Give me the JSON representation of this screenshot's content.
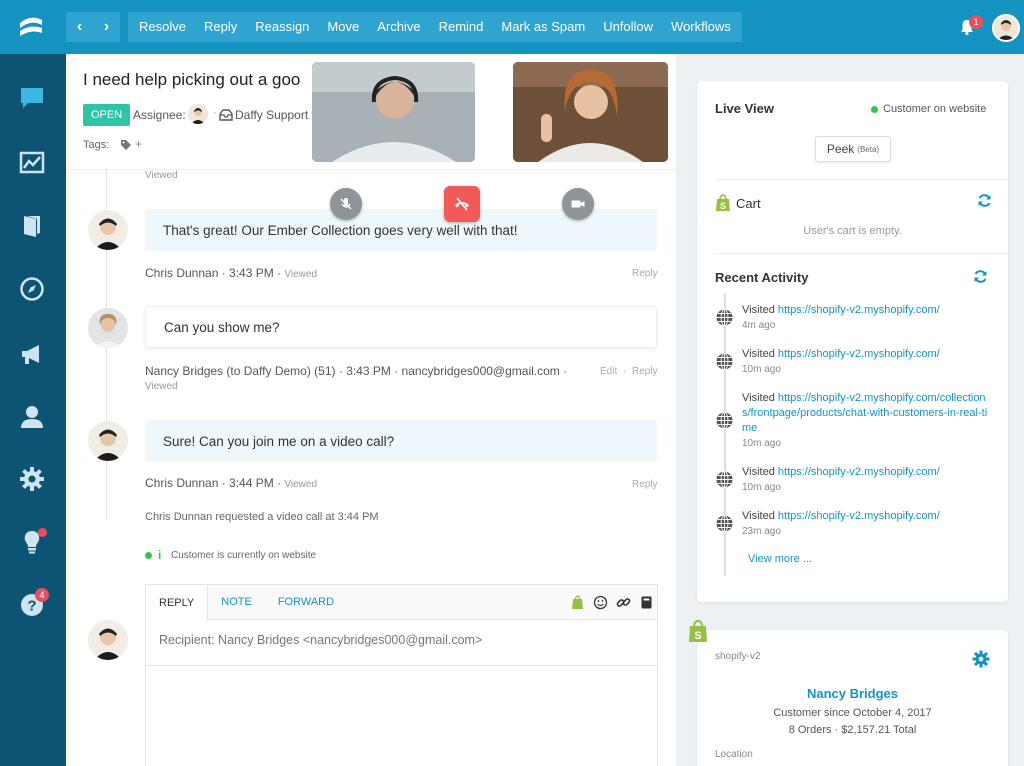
{
  "toolbar": {
    "back": "‹",
    "forward": "›",
    "actions": [
      "Resolve",
      "Reply",
      "Reassign",
      "Move",
      "Archive",
      "Remind",
      "Mark as Spam",
      "Unfollow",
      "Workflows"
    ],
    "notification_count": "1"
  },
  "sidebar": {
    "items": [
      "chat-icon",
      "reports-icon",
      "knowledge-base-icon",
      "compass-icon",
      "campaigns-icon",
      "contacts-icon",
      "settings-icon",
      "ideas-icon",
      "help-icon"
    ],
    "help_badge": "4"
  },
  "conversation": {
    "title": "I need help picking out a goo",
    "status": "OPEN",
    "assignee_label": "Assignee:",
    "separator": "·",
    "team": "Daffy Support v",
    "tags_label": "Tags:",
    "tag_add": "+",
    "first_viewed": "Viewed",
    "messages": [
      {
        "text": "That's great! Our Ember Collection goes very well with that!",
        "author": "Chris Dunnan · 3:43 PM ·",
        "viewed": "Viewed",
        "action": "Reply"
      },
      {
        "text": "Can you show me?",
        "author": "Nancy Bridges (to Daffy Demo) (51) · 3:43 PM · nancybridges000@gmail.com ·",
        "viewed": "Viewed",
        "edit": "Edit",
        "sep": "·",
        "action": "Reply"
      },
      {
        "text": "Sure! Can you join me on a video call?",
        "author": "Chris Dunnan · 3:44 PM ·",
        "viewed": "Viewed",
        "action": "Reply"
      }
    ],
    "system_note": "Chris Dunnan requested a video call at 3:44 PM",
    "info_glyph": "i",
    "online_note": "Customer is currently on website"
  },
  "composer": {
    "tabs": [
      "REPLY",
      "NOTE",
      "FORWARD"
    ],
    "recipient": "Recipient: Nancy Bridges <nancybridges000@gmail.com>"
  },
  "live_view": {
    "title": "Live View",
    "status": "Customer on website",
    "peek_label": "Peek",
    "peek_beta": "(Beta)",
    "cart_title": "Cart",
    "cart_empty": "User's cart is empty.",
    "activity_title": "Recent Activity",
    "activities": [
      {
        "prefix": "Visited",
        "url": "https://shopify-v2.myshopify.com/",
        "time": "4m ago"
      },
      {
        "prefix": "Visited",
        "url": "https://shopify-v2.myshopify.com/",
        "time": "10m ago"
      },
      {
        "prefix": "Visited",
        "url": "https://shopify-v2.myshopify.com/collections/frontpage/products/chat-with-customers-in-real-time",
        "time": "10m ago"
      },
      {
        "prefix": "Visited",
        "url": "https://shopify-v2.myshopify.com/",
        "time": "10m ago"
      },
      {
        "prefix": "Visited",
        "url": "https://shopify-v2.myshopify.com/",
        "time": "23m ago"
      }
    ],
    "view_more": "View more ..."
  },
  "shopify": {
    "store": "shopify-v2",
    "customer_name": "Nancy Bridges",
    "customer_since": "Customer since October 4, 2017",
    "orders": "8 Orders · $2,157.21 Total",
    "location_label": "Location"
  },
  "colors": {
    "accent": "#1593c1",
    "sidebar": "#0d5474",
    "open": "#2ec4a6",
    "danger": "#f25a5a",
    "online": "#3ac24a"
  }
}
